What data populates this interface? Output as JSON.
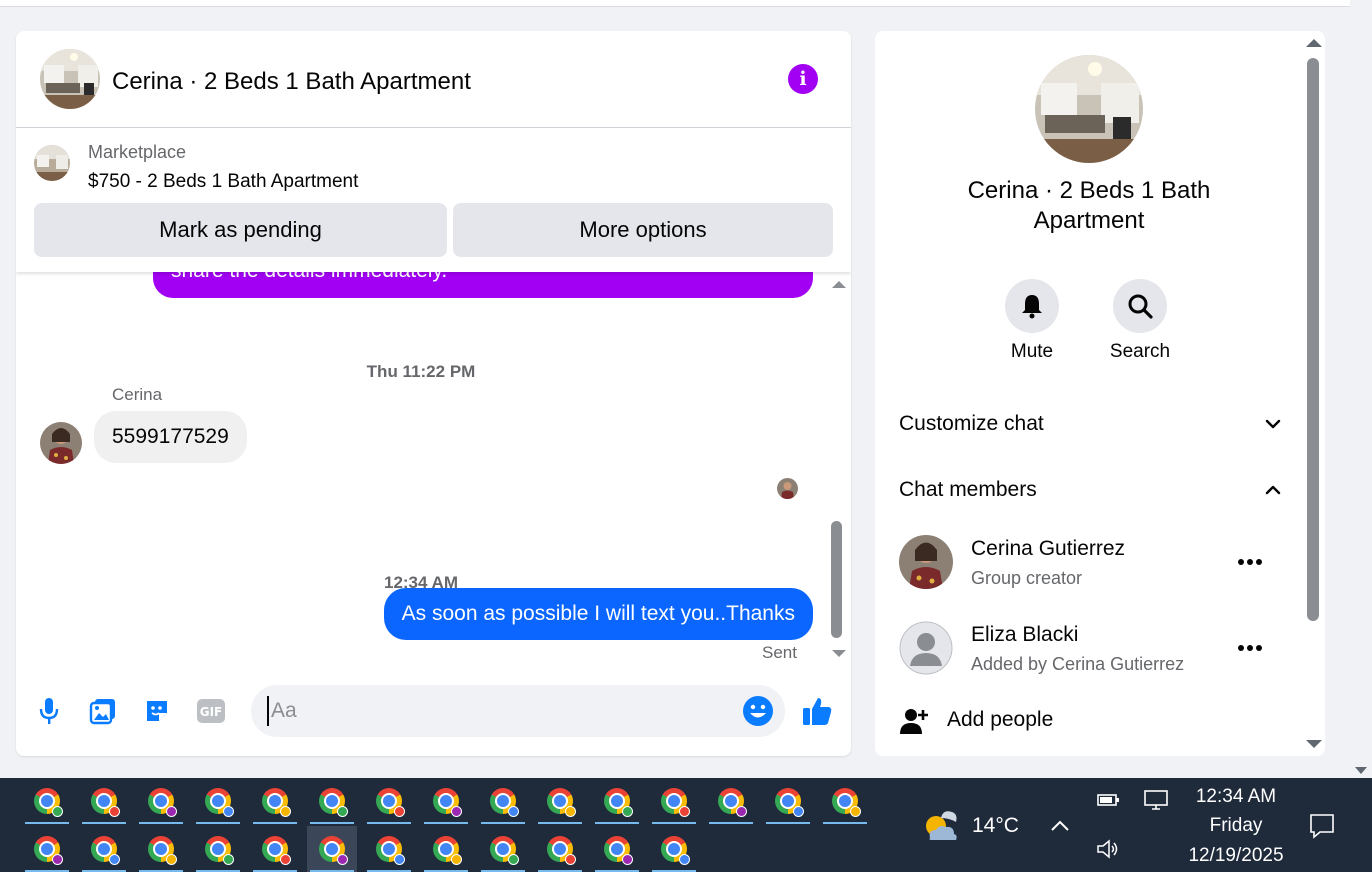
{
  "chat": {
    "title": "Cerina · 2 Beds 1 Bath Apartment",
    "listing": {
      "category": "Marketplace",
      "title": "$750 - 2 Beds 1 Bath Apartment",
      "mark_pending_label": "Mark as pending",
      "more_options_label": "More options"
    },
    "messages": {
      "previous_fragment": "share the details immediately.",
      "timestamp_1": "Thu 11:22 PM",
      "sender_name": "Cerina",
      "incoming_text": "5599177529",
      "timestamp_2": "12:34 AM",
      "outgoing_text": "As soon as possible I will text you..Thanks",
      "status": "Sent"
    },
    "composer": {
      "placeholder": "Aa",
      "icons": [
        "microphone-icon",
        "photo-icon",
        "sticker-icon",
        "gif-icon",
        "emoji-icon",
        "thumbs-up-icon"
      ]
    },
    "colors": {
      "accent": "#a100f2",
      "outgoing": "#0a66ff",
      "thumbs": "#0a7cff"
    }
  },
  "side": {
    "title": "Cerina · 2 Beds 1 Bath Apartment",
    "mute_label": "Mute",
    "search_label": "Search",
    "customize_label": "Customize chat",
    "members_label": "Chat members",
    "members": [
      {
        "name": "Cerina Gutierrez",
        "subtitle": "Group creator"
      },
      {
        "name": "Eliza Blacki",
        "subtitle": "Added by Cerina Gutierrez"
      }
    ],
    "add_people_label": "Add people"
  },
  "taskbar": {
    "temperature": "14°C",
    "time": "12:34 AM",
    "day": "Friday",
    "date": "12/19/2025"
  }
}
